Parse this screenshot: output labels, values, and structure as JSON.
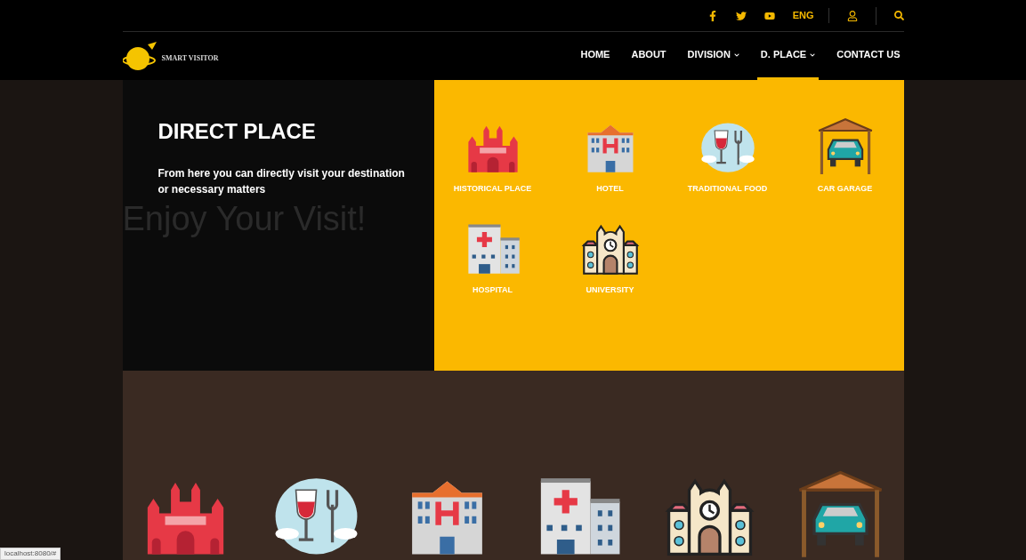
{
  "top_bar": {
    "language": "ENG"
  },
  "logo": {
    "text": "SMART VISITOR"
  },
  "nav": [
    {
      "label": "HOME",
      "selected": false,
      "dropdown": false
    },
    {
      "label": "ABOUT",
      "selected": false,
      "dropdown": false
    },
    {
      "label": "DIVISION",
      "selected": false,
      "dropdown": true
    },
    {
      "label": "D. PLACE",
      "selected": true,
      "dropdown": true
    },
    {
      "label": "CONTACT US",
      "selected": false,
      "dropdown": false
    }
  ],
  "mega_menu": {
    "title": "DIRECT PLACE",
    "description": "From here you can directly visit your destination or necessary matters",
    "items": [
      {
        "label": "HISTORICAL PLACE",
        "kind": "fort"
      },
      {
        "label": "HOTEL",
        "kind": "hotel"
      },
      {
        "label": "TRADITIONAL FOOD",
        "kind": "food"
      },
      {
        "label": "CAR GARAGE",
        "kind": "garage"
      },
      {
        "label": "HOSPITAL",
        "kind": "hospital"
      },
      {
        "label": "UNIVERSITY",
        "kind": "university"
      }
    ]
  },
  "hero": {
    "heading": "Enjoy Your Visit!"
  },
  "status_bar": {
    "url": "localhost:8080/#"
  }
}
